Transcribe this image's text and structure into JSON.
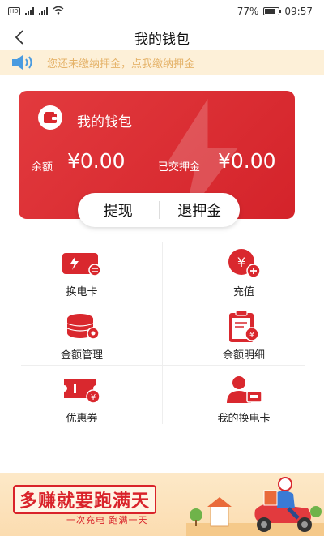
{
  "status_bar": {
    "left": "HD 4G 2G",
    "battery": "77%",
    "time": "09:57"
  },
  "nav": {
    "back_glyph": "‹",
    "title": "我的钱包"
  },
  "notice": {
    "text": "您还未缴纳押金，点我缴纳押金",
    "icon": "speaker-icon"
  },
  "wallet_card": {
    "title": "我的钱包",
    "balance_label": "余额",
    "balance_value": "¥0.00",
    "deposit_label": "已交押金",
    "deposit_value": "¥0.00",
    "accent": "#d9282e"
  },
  "actions": {
    "withdraw": "提现",
    "refund_deposit": "退押金"
  },
  "grid": [
    {
      "label": "换电卡",
      "icon": "battery-card-icon"
    },
    {
      "label": "充值",
      "icon": "recharge-icon"
    },
    {
      "label": "金额管理",
      "icon": "coins-icon"
    },
    {
      "label": "余额明细",
      "icon": "clipboard-icon"
    },
    {
      "label": "优惠券",
      "icon": "coupon-icon"
    },
    {
      "label": "我的换电卡",
      "icon": "user-card-icon"
    }
  ],
  "banner": {
    "headline": "多赚就要跑满天",
    "sub": "一次充电 跑满一天"
  }
}
